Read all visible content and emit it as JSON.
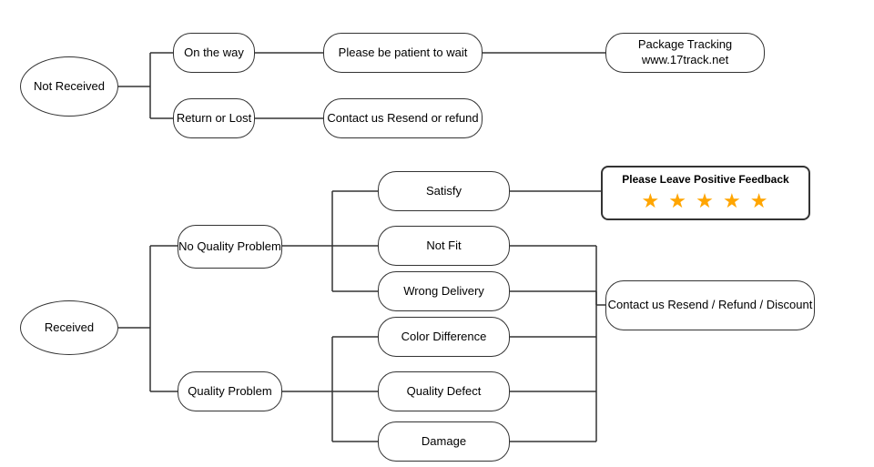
{
  "nodes": {
    "not_received": {
      "label": "Not\nReceived"
    },
    "on_the_way": {
      "label": "On the way"
    },
    "please_patient": {
      "label": "Please be patient to wait"
    },
    "package_tracking": {
      "label": "Package Tracking\nwww.17track.net"
    },
    "return_or_lost": {
      "label": "Return or Lost"
    },
    "contact_us_resend": {
      "label": "Contact us\nResend or refund"
    },
    "received": {
      "label": "Received"
    },
    "no_quality_problem": {
      "label": "No\nQuality Problem"
    },
    "satisfy": {
      "label": "Satisfy"
    },
    "not_fit": {
      "label": "Not Fit"
    },
    "wrong_delivery": {
      "label": "Wrong Delivery"
    },
    "quality_problem": {
      "label": "Quality Problem"
    },
    "color_difference": {
      "label": "Color Difference"
    },
    "quality_defect": {
      "label": "Quality Defect"
    },
    "damage": {
      "label": "Damage"
    },
    "feedback": {
      "title": "Please Leave Positive Feedback",
      "stars": "★ ★ ★ ★ ★"
    },
    "contact_us_full": {
      "label": "Contact us\nResend / Refund / Discount"
    }
  }
}
